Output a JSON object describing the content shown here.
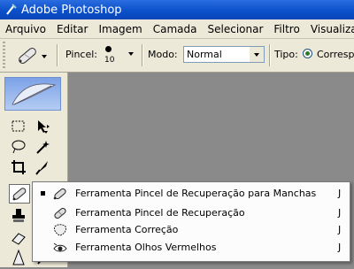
{
  "window": {
    "title": "Adobe Photoshop"
  },
  "menu": {
    "items": [
      "Arquivo",
      "Editar",
      "Imagem",
      "Camada",
      "Selecionar",
      "Filtro",
      "Visualizar"
    ]
  },
  "options": {
    "brush_label": "Pincel:",
    "brush_size": "10",
    "mode_label": "Modo:",
    "mode_value": "Normal",
    "type_label": "Tipo:",
    "type_option": "Corresp"
  },
  "flyout": {
    "items": [
      {
        "label": "Ferramenta Pincel de Recuperação para Manchas",
        "shortcut": "J",
        "selected": true,
        "icon": "spot-healing-brush-icon"
      },
      {
        "label": "Ferramenta Pincel de Recuperação",
        "shortcut": "J",
        "selected": false,
        "icon": "healing-brush-icon"
      },
      {
        "label": "Ferramenta Correção",
        "shortcut": "J",
        "selected": false,
        "icon": "patch-icon"
      },
      {
        "label": "Ferramenta Olhos Vermelhos",
        "shortcut": "J",
        "selected": false,
        "icon": "red-eye-icon"
      }
    ]
  },
  "colors": {
    "titlebar": "#0a4ec8",
    "workspace": "#8a8a8a",
    "chrome": "#ece9d8"
  }
}
